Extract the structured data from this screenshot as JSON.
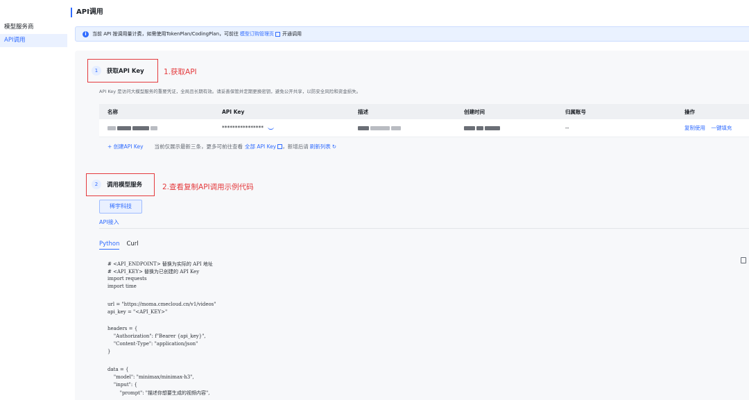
{
  "page_title": "API调用",
  "sidebar": {
    "items": [
      {
        "label": "模型服务商",
        "active": false
      },
      {
        "label": "API调用",
        "active": true
      }
    ]
  },
  "banner": {
    "text_before": "当前 API 按调用量计费，如需使用TokenPlan/CodingPlan，可前往",
    "link": "模型订购管理页",
    "text_after": "开通调用"
  },
  "step1": {
    "num": "1",
    "title": "获取API Key",
    "annotation": "1.获取API",
    "description": "API Key 是访问大模型服务的重要凭证，全局且长期有效。请妥善保管并定期更换密钥，避免公开共享，以防安全风险和资金损失。"
  },
  "table": {
    "headers": [
      "名称",
      "API Key",
      "描述",
      "创建时间",
      "归属账号",
      "操作"
    ],
    "row": {
      "api_key": "****************",
      "account": "--",
      "action_copy": "复制使用",
      "action_fill": "一键填充"
    }
  },
  "create": {
    "button": "+ 创建API Key",
    "hint_before": "当前仅展示最新三条，更多可前往查看",
    "all_link": "全部 API Key",
    "hint_mid": "，新增后请",
    "refresh_link": "刷新列表"
  },
  "step2": {
    "num": "2",
    "title": "调用模型服务",
    "annotation": "2.查看复制API调用示例代码"
  },
  "vendor_button": "稀宇科技",
  "tab_api": "API接入",
  "lang_tabs": [
    "Python",
    "Curl"
  ],
  "code_lines": [
    "# <API_ENDPOINT> 替换为实际的 API 地址",
    "# <API_KEY> 替换为已创建的 API Key",
    "import requests",
    "import time",
    "",
    "url = \"https://moma.cmecloud.cn/v1/videos\"",
    "api_key = \"<API_KEY>\"",
    "",
    "headers = {",
    "    \"Authorization\": f\"Bearer {api_key}\",",
    "    \"Content-Type\": \"application/json\"",
    "}",
    "",
    "data = {",
    "    \"model\": \"minimax/minimax-h3\",",
    "    \"input\": {",
    "        \"prompt\": \"描述你想要生成的视频内容\","
  ],
  "colors": {
    "accent": "#2f6bff",
    "annotation": "#e4393c"
  }
}
